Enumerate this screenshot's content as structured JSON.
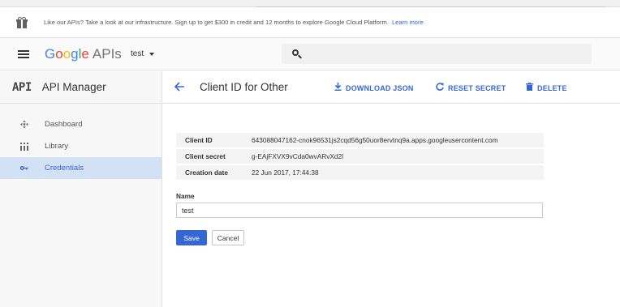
{
  "promo": {
    "text": "Like our APIs? Take a look at our infrastructure. Sign up to get $300 in credit and 12 months to explore Google Cloud Platform.",
    "link": "Learn more"
  },
  "header": {
    "logo_letters": [
      "G",
      "o",
      "o",
      "g",
      "l",
      "e"
    ],
    "logo_suffix": "APIs",
    "project": "test"
  },
  "sidebar": {
    "icon_text": "API",
    "title": "API Manager",
    "items": [
      {
        "label": "Dashboard",
        "icon": "dashboard-icon",
        "active": false
      },
      {
        "label": "Library",
        "icon": "library-icon",
        "active": false
      },
      {
        "label": "Credentials",
        "icon": "key-icon",
        "active": true
      }
    ]
  },
  "main": {
    "title": "Client ID for Other",
    "actions": {
      "download": "DOWNLOAD JSON",
      "reset": "RESET SECRET",
      "delete": "DELETE"
    },
    "details": [
      {
        "key": "Client ID",
        "value": "643088047162-cnok96531js2cqd56g50uor8ervtnq9a.apps.googleusercontent.com"
      },
      {
        "key": "Client secret",
        "value": "g-EAjFXVX9vCda0wvARvXd2l"
      },
      {
        "key": "Creation date",
        "value": "22 Jun 2017, 17:44:38"
      }
    ],
    "name_label": "Name",
    "name_value": "test",
    "save": "Save",
    "cancel": "Cancel"
  },
  "colors": {
    "accent": "#3367d6",
    "active_bg": "#d3e1f5"
  }
}
